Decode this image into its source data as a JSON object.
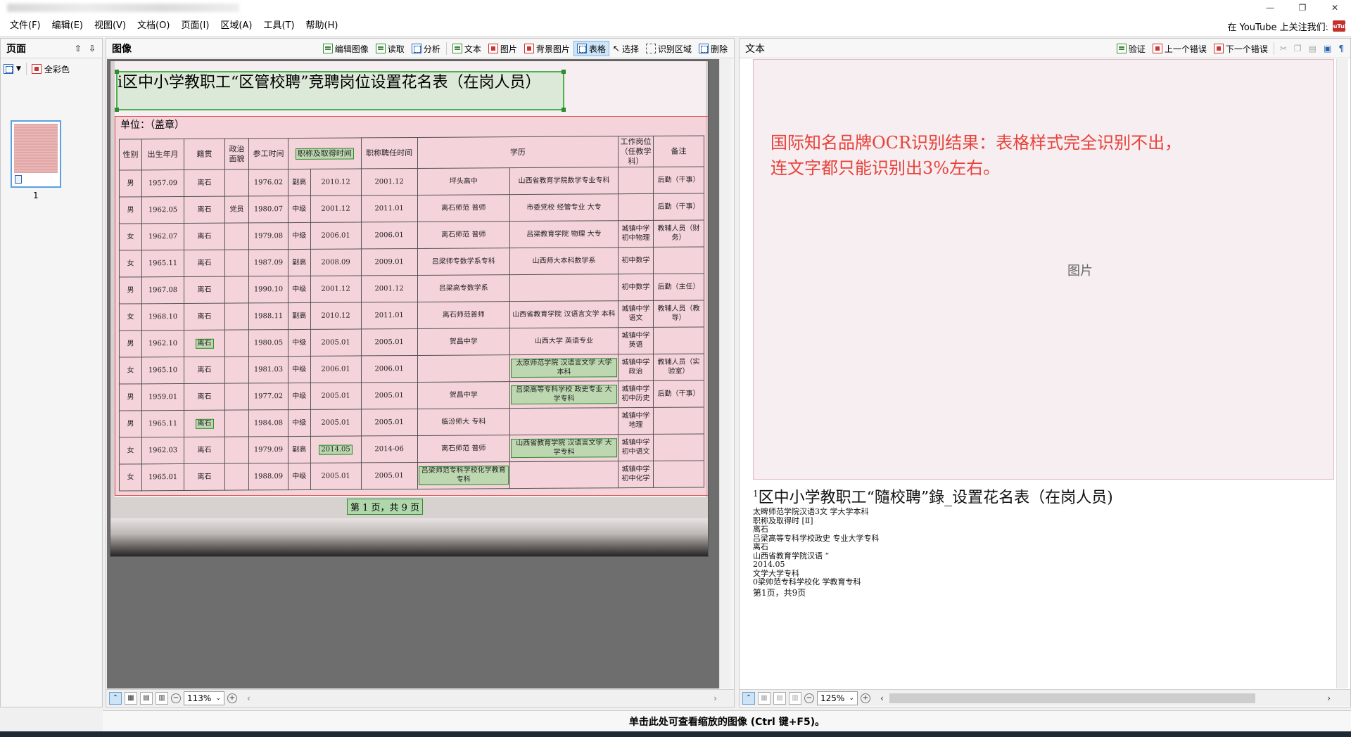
{
  "menu": [
    "文件(F)",
    "编辑(E)",
    "视图(V)",
    "文档(O)",
    "页面(I)",
    "区域(A)",
    "工具(T)",
    "帮助(H)"
  ],
  "youtube_text": "在 YouTube 上关注我们:",
  "youtube_icon": "YouTube",
  "pages_panel": {
    "title": "页面",
    "mode_label": "全彩色",
    "thumb_number": "1"
  },
  "image_panel": {
    "title": "图像",
    "toolbar": [
      "编辑图像",
      "读取",
      "分析",
      "文本",
      "图片",
      "背景图片",
      "表格",
      "选择",
      "识别区域",
      "删除"
    ],
    "active_tool": "表格",
    "zoom": "113%"
  },
  "doc": {
    "header": "i区中小学教职工“区管校聘”竞聘岗位设置花名表（在岗人员）",
    "unit": "单位：（盖章）",
    "columns": [
      "性别",
      "出生年月",
      "籍贯",
      "政治面貌",
      "参工时间",
      "职称及取得时间",
      "",
      "职称聘任时间",
      "学历",
      "",
      "工作岗位（任教学科）",
      "备注"
    ],
    "rows": [
      [
        "男",
        "1957.09",
        "离石",
        "",
        "1976.02",
        "副高",
        "2010.12",
        "2001.12",
        "坪头高中",
        "山西省教育学院数学专业专科",
        "",
        "后勤（干事）"
      ],
      [
        "男",
        "1962.05",
        "离石",
        "党员",
        "1980.07",
        "中级",
        "2001.12",
        "2011.01",
        "离石师范 普师",
        "市委党校 经管专业 大专",
        "",
        "后勤（干事）"
      ],
      [
        "女",
        "1962.07",
        "离石",
        "",
        "1979.08",
        "中级",
        "2006.01",
        "2006.01",
        "离石师范 普师",
        "吕梁教育学院 物理 大专",
        "城镇中学初中物理",
        "教辅人员（财务）"
      ],
      [
        "女",
        "1965.11",
        "离石",
        "",
        "1987.09",
        "副高",
        "2008.09",
        "2009.01",
        "吕梁师专数学系专科",
        "山西师大本科数学系",
        "初中数学",
        ""
      ],
      [
        "男",
        "1967.08",
        "离石",
        "",
        "1990.10",
        "中级",
        "2001.12",
        "2001.12",
        "吕梁高专数学系",
        "",
        "初中数学",
        "后勤（主任）"
      ],
      [
        "女",
        "1968.10",
        "离石",
        "",
        "1988.11",
        "副高",
        "2010.12",
        "2011.01",
        "离石师范普师",
        "山西省教育学院 汉语言文学 本科",
        "城镇中学语文",
        "教辅人员（教导）"
      ],
      [
        "男",
        "1962.10",
        "离石",
        "",
        "1980.05",
        "中级",
        "2005.01",
        "2005.01",
        "贺昌中学",
        "山西大学 英语专业",
        "城镇中学英语",
        ""
      ],
      [
        "女",
        "1965.10",
        "离石",
        "",
        "1981.03",
        "中级",
        "2006.01",
        "2006.01",
        "",
        "太原师范学院 汉语言文学 大学本科",
        "城镇中学政治",
        "教辅人员（实验室）"
      ],
      [
        "男",
        "1959.01",
        "离石",
        "",
        "1977.02",
        "中级",
        "2005.01",
        "2005.01",
        "贺昌中学",
        "吕梁高等专科学校 政史专业 大学专科",
        "城镇中学初中历史",
        "后勤（干事）"
      ],
      [
        "男",
        "1965.11",
        "离石",
        "",
        "1984.08",
        "中级",
        "2005.01",
        "2005.01",
        "临汾师大 专科",
        "",
        "城镇中学地理",
        ""
      ],
      [
        "女",
        "1962.03",
        "离石",
        "",
        "1979.09",
        "副高",
        "2014.05",
        "2014-06",
        "离石师范 普师",
        "山西省教育学院 汉语言文学 大学专科",
        "城镇中学初中语文",
        ""
      ],
      [
        "女",
        "1965.01",
        "离石",
        "",
        "1988.09",
        "中级",
        "2005.01",
        "2005.01",
        "吕梁师范专科学校化学教育专科",
        "",
        "城镇中学初中化学",
        ""
      ]
    ],
    "pager": "第 1 页，共 9 页"
  },
  "text_panel": {
    "title": "文本",
    "toolbar": [
      "验证",
      "上一个错误",
      "下一个错误"
    ],
    "red_message_line1": "国际知名品牌OCR识别结果：表格样式完全识别不出，",
    "red_message_line2": "连文字都只能识别出3%左右。",
    "picture_label": "图片",
    "ocr_sup": "1",
    "ocr_title": "区中小学教职工“隨校聘”錄_设置花名表（在岗人员)",
    "ocr_lines": [
      "太睥师范学院汉语3文  学大学本科",
      "职称及取得时 [Ⅱ]",
      "离石",
      "吕梁高等专科学校政史  专业大学专科",
      "离石",
      "山西省教育学院汉语 “",
      "2014.05",
      "文学大学专科",
      "0梁帅范专科学校化  学教育专科",
      "第1页，共9页"
    ],
    "zoom": "125%"
  },
  "status_message": "单击此处可查看缩放的图像 (Ctrl 键+F5)。"
}
